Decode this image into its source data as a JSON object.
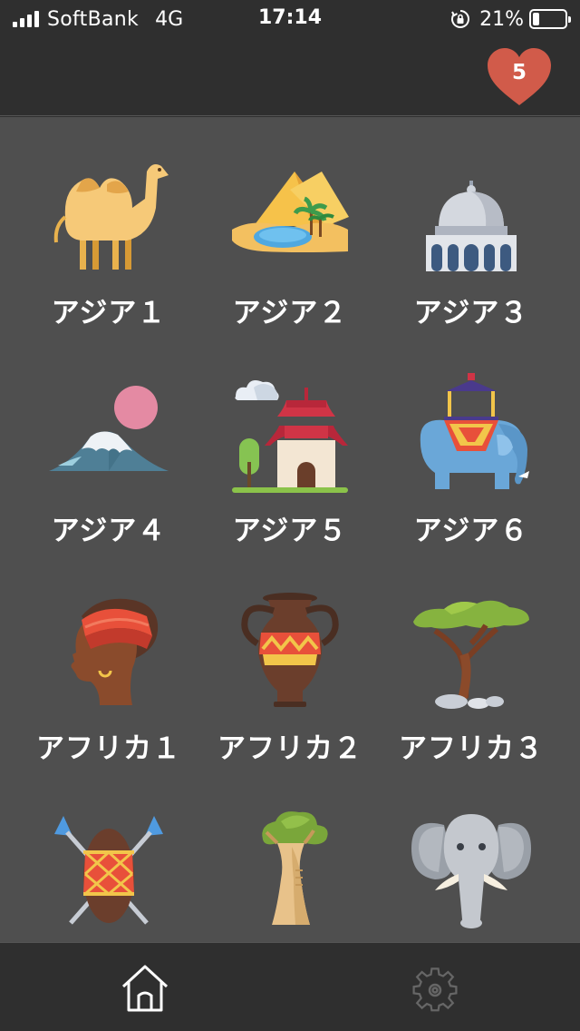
{
  "status_bar": {
    "carrier": "SoftBank",
    "network": "4G",
    "time": "17:14",
    "battery_percent": "21%",
    "battery_level": 0.21,
    "icons": [
      "signal-icon",
      "rotation-lock-icon",
      "battery-icon"
    ]
  },
  "header": {
    "lives_count": "5",
    "lives_icon": "heart-icon",
    "lives_color": "#d15b4a"
  },
  "levels": [
    {
      "label": "アジア１",
      "icon": "camel-icon"
    },
    {
      "label": "アジア２",
      "icon": "desert-oasis-icon"
    },
    {
      "label": "アジア３",
      "icon": "mosque-dome-icon"
    },
    {
      "label": "アジア４",
      "icon": "mount-fuji-icon"
    },
    {
      "label": "アジア５",
      "icon": "chinese-temple-icon"
    },
    {
      "label": "アジア６",
      "icon": "decorated-elephant-icon"
    },
    {
      "label": "アフリカ１",
      "icon": "african-woman-icon"
    },
    {
      "label": "アフリカ２",
      "icon": "amphora-vase-icon"
    },
    {
      "label": "アフリカ３",
      "icon": "acacia-tree-icon"
    },
    {
      "label": "",
      "icon": "shield-spears-icon"
    },
    {
      "label": "",
      "icon": "baobab-tree-icon"
    },
    {
      "label": "",
      "icon": "elephant-head-icon"
    }
  ],
  "tabbar": {
    "tabs": [
      {
        "icon": "home-icon",
        "active": true
      },
      {
        "icon": "gear-icon",
        "active": false
      }
    ]
  },
  "colors": {
    "background": "#4f4f4f",
    "bar": "#2f2f2f",
    "heart": "#d15b4a"
  }
}
